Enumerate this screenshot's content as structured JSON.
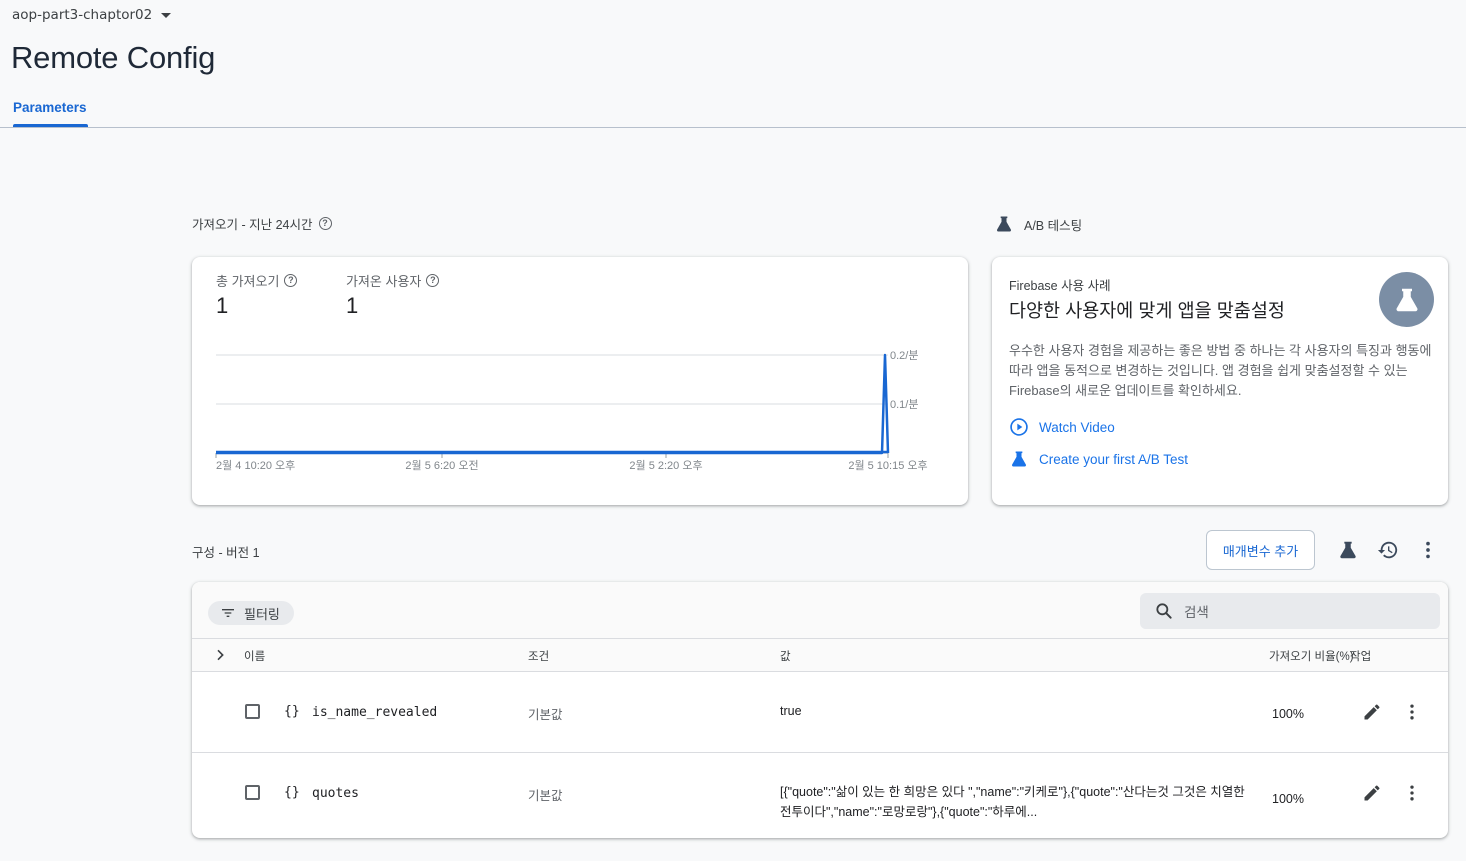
{
  "header": {
    "project": "aop-part3-chaptor02",
    "title": "Remote Config",
    "tab": "Parameters"
  },
  "fetch_section": {
    "label": "가져오기 - 지난 24시간",
    "metrics": [
      {
        "label": "총 가져오기",
        "value": "1"
      },
      {
        "label": "가져온 사용자",
        "value": "1"
      }
    ]
  },
  "chart_data": {
    "type": "line",
    "x": [
      "2월 4 10:20 오후",
      "2월 5 6:20 오전",
      "2월 5 2:20 오후",
      "2월 5 10:15 오후"
    ],
    "x_tick_labels": [
      "2월 4 10:20 오후",
      "2월 5 6:20 오전",
      "2월 5 2:20 오후",
      "2월 5 10:15 오후"
    ],
    "y_tick_labels": [
      "0.1/분",
      "0.2/분"
    ],
    "ylim": [
      0,
      0.2
    ],
    "series": [
      {
        "values": [
          0,
          0,
          0,
          0,
          0,
          0.2,
          0
        ],
        "color": "#1967d2"
      }
    ],
    "grid": true
  },
  "ab_section": {
    "label": "A/B 테스팅",
    "eyebrow": "Firebase 사용 사례",
    "title": "다양한 사용자에 맞게 앱을 맞춤설정",
    "description": "우수한 사용자 경험을 제공하는 좋은 방법 중 하나는 각 사용자의 특징과 행동에 따라 앱을 동적으로 변경하는 것입니다. 앱 경험을 쉽게 맞춤설정할 수 있는 Firebase의 새로운 업데이트를 확인하세요.",
    "watch_video": "Watch Video",
    "create_test": "Create your first A/B Test"
  },
  "config": {
    "label": "구성 - 버전 1",
    "add_param": "매개변수 추가",
    "filter": "필터링",
    "search_placeholder": "검색",
    "columns": {
      "name": "이름",
      "condition": "조건",
      "value": "값",
      "fetch_pct": "가져오기 비율(%)",
      "action": "작업"
    },
    "rows": [
      {
        "name": "is_name_revealed",
        "condition": "기본값",
        "value": "true",
        "pct": "100%"
      },
      {
        "name": "quotes",
        "condition": "기본값",
        "value": "[{\"quote\":\"삶이 있는 한 희망은 있다 \",\"name\":\"키케로\"},{\"quote\":\"산다는것 그것은 치열한 전투이다\",\"name\":\"로망로랑\"},{\"quote\":\"하루에...",
        "pct": "100%"
      }
    ]
  },
  "colors": {
    "accent": "#1967d2",
    "link": "#1a73e8",
    "badge": "#7b8ea5"
  }
}
